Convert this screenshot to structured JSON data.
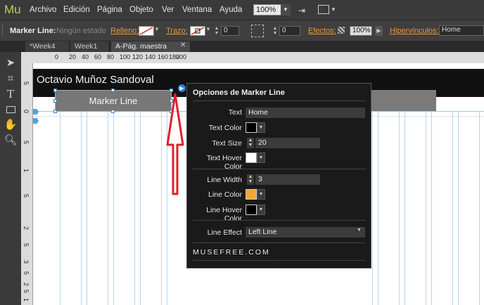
{
  "app": {
    "logo": "Mu"
  },
  "menu": [
    "Archivo",
    "Edición",
    "Página",
    "Objeto",
    "Ver",
    "Ventana",
    "Ayuda"
  ],
  "zoom": "100%",
  "controlbar": {
    "element_label": "Marker Line:",
    "state": "Ningún estado",
    "fill_label": "Relleno:",
    "stroke_label": "Trazo:",
    "stroke_width": "0",
    "corner_radius": "0",
    "effects_label": "Efectos:",
    "opacity": "100%",
    "hyperlinks_label": "Hipervínculos:",
    "hyperlink_value": "Home"
  },
  "tabs": [
    "*Week4",
    "Week1",
    "A-Pág. maestra"
  ],
  "ruler_h": [
    "0",
    "20",
    "40",
    "60",
    "80",
    "100",
    "120",
    "140",
    "160",
    "180",
    "200"
  ],
  "ruler_v": [
    "5",
    "0",
    "5",
    "1",
    "5",
    "2",
    "5",
    "3",
    "5",
    "2",
    "5",
    "1"
  ],
  "canvas": {
    "site_title": "Octavio Muñoz Sandoval",
    "marker_button": "Marker Line"
  },
  "panel": {
    "title": "Opciones de Marker Line",
    "text_label": "Text",
    "text_value": "Home",
    "text_color_label": "Text Color",
    "text_size_label": "Text Size",
    "text_size_value": "20",
    "text_hover_color_label": "Text Hover Color",
    "line_width_label": "Line Width",
    "line_width_value": "3",
    "line_color_label": "Line Color",
    "line_hover_color_label": "Line Hover Color",
    "line_effect_label": "Line Effect",
    "line_effect_value": "Left Line",
    "brand": "MUSEFREE.COM"
  },
  "colors": {
    "accent_link": "#e59843",
    "line_color": "#f0a830",
    "arrow": "#e0202a"
  }
}
